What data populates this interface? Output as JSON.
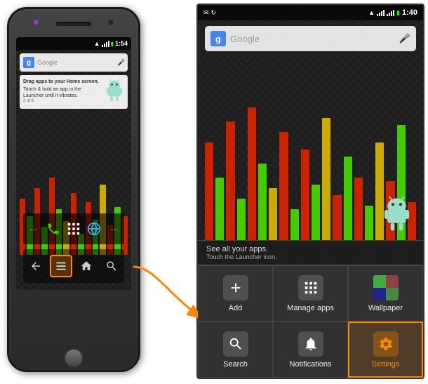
{
  "left_phone": {
    "status_time": "1:54",
    "search_placeholder": "Google",
    "tutorial_title": "Drag apps to your Home screen.",
    "tutorial_body": "Touch & hold an app in the Launcher until it vibrates.",
    "tutorial_counter": "2 of 6",
    "dock_items": [
      "...",
      "phone",
      "launcher",
      "globe",
      "..."
    ],
    "nav_items": [
      "back",
      "menu",
      "home",
      "search"
    ]
  },
  "right_screen": {
    "status_time": "1:40",
    "search_placeholder": "Google",
    "see_all_text": "See all your apps.",
    "see_all_sub": "Touch the Launcher icon.",
    "menu_items": [
      {
        "id": "add",
        "label": "Add",
        "icon": "➕"
      },
      {
        "id": "manage_apps",
        "label": "Manage apps",
        "icon": "⊞"
      },
      {
        "id": "wallpaper",
        "label": "Wallpaper",
        "icon": "img"
      },
      {
        "id": "search",
        "label": "Search",
        "icon": "🔍"
      },
      {
        "id": "notifications",
        "label": "Notifications",
        "icon": "❗"
      },
      {
        "id": "settings",
        "label": "Settings",
        "icon": "⚙"
      }
    ]
  },
  "colors": {
    "orange_accent": "#ff8800",
    "green_bar": "#44cc00",
    "red_bar": "#cc2200",
    "yellow_bar": "#ccaa00"
  }
}
